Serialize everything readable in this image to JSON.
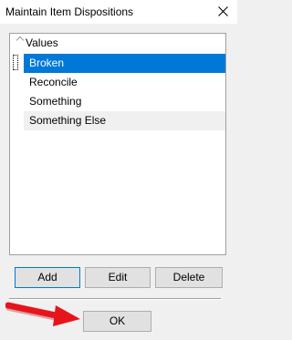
{
  "window": {
    "title": "Maintain Item Dispositions",
    "close_icon": "close-icon"
  },
  "list": {
    "column_header": "Values",
    "sort_icon": "chevron-up-icon",
    "rows": [
      {
        "label": "Broken",
        "selected": true
      },
      {
        "label": "Reconcile",
        "selected": false
      },
      {
        "label": "Something",
        "selected": false
      },
      {
        "label": "Something Else",
        "selected": false
      }
    ]
  },
  "buttons": {
    "add": "Add",
    "edit": "Edit",
    "delete": "Delete",
    "ok": "OK"
  },
  "annotation": {
    "arrow_icon": "red-arrow-icon",
    "arrow_color": "#e8141b"
  },
  "colors": {
    "selection": "#0078d7",
    "window_bg": "#f0f0f0"
  }
}
